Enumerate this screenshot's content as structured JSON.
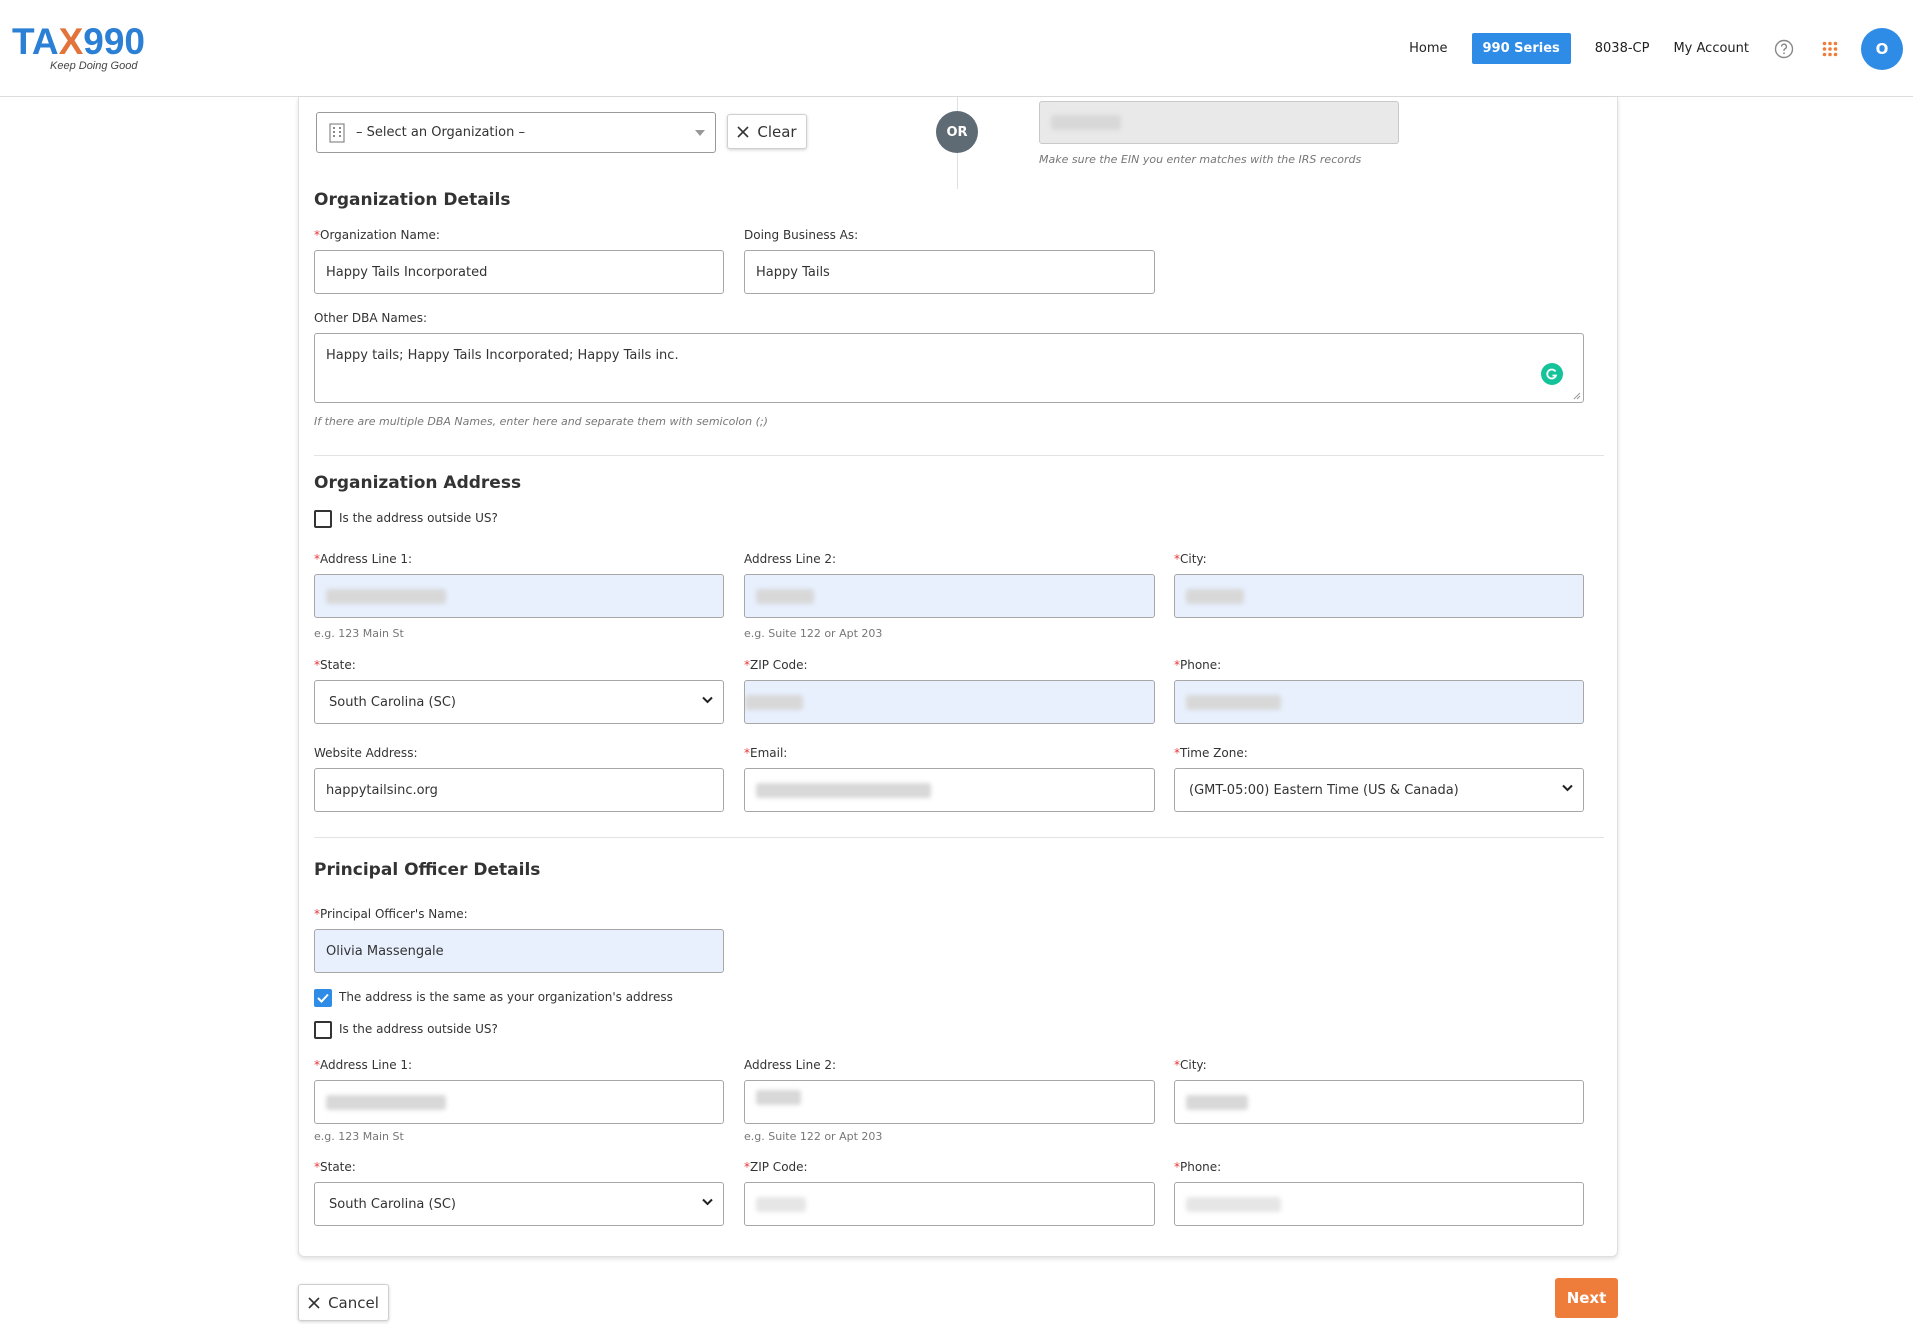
{
  "header": {
    "logo_text_part1": "TA",
    "logo_text_x": "X",
    "logo_text_part2": "990",
    "logo_tagline": "Keep Doing Good",
    "nav": {
      "home": "Home",
      "series_990": "990 Series",
      "form_8038cp": "8038-CP",
      "my_account": "My Account"
    },
    "avatar_initial": "O"
  },
  "org_select": {
    "placeholder": "– Select an Organization –",
    "clear_label": "Clear",
    "or_label": "OR",
    "ein_hint": "Make sure the EIN you enter matches with the IRS records"
  },
  "org_details": {
    "title": "Organization Details",
    "name_label": "Organization Name:",
    "name_value": "Happy Tails Incorporated",
    "dba_label": "Doing Business As:",
    "dba_value": "Happy Tails",
    "other_dba_label": "Other DBA Names:",
    "other_dba_value": "Happy tails; Happy Tails Incorporated; Happy Tails inc.",
    "other_dba_hint": "If there are multiple DBA Names, enter here and separate them with semicolon (;)"
  },
  "org_address": {
    "title": "Organization Address",
    "outside_us_label": "Is the address outside US?",
    "address1_label": "Address Line 1:",
    "address1_hint": "e.g. 123 Main St",
    "address2_label": "Address Line 2:",
    "address2_hint": "e.g. Suite 122 or Apt 203",
    "city_label": "City:",
    "state_label": "State:",
    "state_value": "South Carolina (SC)",
    "zip_label": "ZIP Code:",
    "phone_label": "Phone:",
    "website_label": "Website Address:",
    "website_value": "happytailsinc.org",
    "email_label": "Email:",
    "timezone_label": "Time Zone:",
    "timezone_value": "(GMT-05:00) Eastern Time (US & Canada)"
  },
  "principal_officer": {
    "title": "Principal Officer Details",
    "name_label": "Principal Officer's Name:",
    "name_value": "Olivia Massengale",
    "same_address_label": "The address is the same as your organization's address",
    "same_address_checked": true,
    "outside_us_label": "Is the address outside US?",
    "outside_us_checked": false,
    "address1_label": "Address Line 1:",
    "address1_hint": "e.g. 123 Main St",
    "address2_label": "Address Line 2:",
    "address2_hint": "e.g. Suite 122 or Apt 203",
    "city_label": "City:",
    "state_label": "State:",
    "state_value": "South Carolina (SC)",
    "zip_label": "ZIP Code:",
    "phone_label": "Phone:"
  },
  "footer": {
    "cancel_label": "Cancel",
    "next_label": "Next"
  },
  "colors": {
    "brand_blue": "#2e8ce6",
    "brand_orange": "#ee7d3c",
    "autofill_blue": "#e8f0fe",
    "required_red": "#e53935"
  }
}
